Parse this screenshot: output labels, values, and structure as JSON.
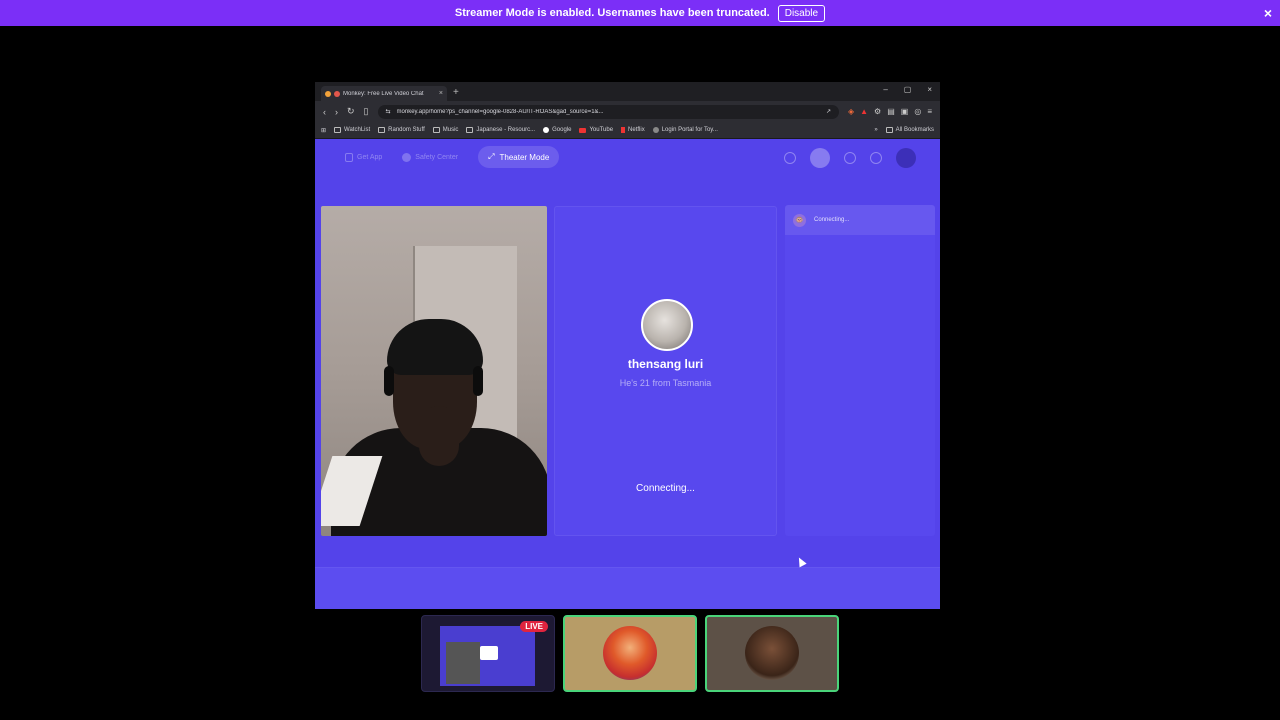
{
  "streamer_banner": {
    "message": "Streamer Mode is enabled. Usernames have been truncated.",
    "disable_label": "Disable",
    "close_icon": "×"
  },
  "browser": {
    "tab": {
      "title": "Monkey: Free Live Video Chat",
      "close": "×"
    },
    "new_tab": "+",
    "window_controls": {
      "minimize": "–",
      "maximize": "▢",
      "close": "×"
    },
    "url": "monkey.app/home?ps_channel=google-0828-AU/IT-ROAS&gad_source=1&...",
    "bookmarks": [
      "WatchList",
      "Random Stuff",
      "Music",
      "Japanese - Resourc...",
      "Google",
      "YouTube",
      "Netflix",
      "Login Portal for Toy..."
    ],
    "bookmarks_more": "»",
    "all_bookmarks": "All Bookmarks"
  },
  "app": {
    "nav": {
      "get_app": "Get App",
      "safety_center": "Safety Center",
      "theater_mode": "Theater Mode"
    },
    "partner": {
      "name": "thensang luri",
      "info": "He's 21 from Tasmania"
    },
    "status_main": "Connecting...",
    "chat_status": "Connecting..."
  },
  "participants": {
    "live_label": "LIVE"
  },
  "colors": {
    "banner": "#7b2ff7",
    "page_bg": "#5443ea",
    "live": "#e0243f",
    "active_border": "#4ad47a"
  }
}
